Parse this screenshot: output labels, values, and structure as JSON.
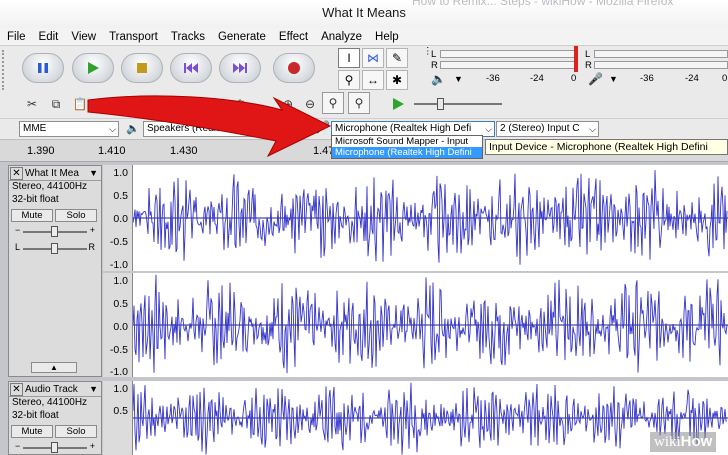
{
  "window": {
    "ghost_title": "How to Remix... Steps - wikiHow - Mozilla Firefox",
    "title": "What It Means"
  },
  "menu": [
    "File",
    "Edit",
    "View",
    "Transport",
    "Tracks",
    "Generate",
    "Effect",
    "Analyze",
    "Help"
  ],
  "transport": {
    "pause": "pause-icon",
    "play": "play-icon",
    "stop": "stop-icon",
    "skip_start": "skip-to-start-icon",
    "skip_end": "skip-to-end-icon",
    "record": "record-icon"
  },
  "meters": {
    "playback_l": "L",
    "playback_r": "R",
    "record_l": "L",
    "record_r": "R",
    "scale_left": [
      "-36",
      "-24",
      "0"
    ],
    "scale_right": [
      "-36",
      "-24",
      "0"
    ]
  },
  "devices": {
    "host": "MME",
    "output": "Speakers (Realtek High De",
    "input": "Microphone (Realtek High Defi",
    "channels": "2 (Stereo) Input C"
  },
  "input_dropdown_options": [
    "Microsoft Sound Mapper - Input",
    "Microphone (Realtek High Defini"
  ],
  "tooltip": "Input Device - Microphone (Realtek High Defini",
  "ruler": [
    "1.390",
    "1.410",
    "1.430",
    "1.47"
  ],
  "tracks": [
    {
      "name": "What It Mea",
      "format": "Stereo, 44100Hz",
      "bitdepth": "32-bit float",
      "mute": "Mute",
      "solo": "Solo",
      "pan_l": "L",
      "pan_r": "R",
      "scale_top": [
        "1.0",
        "0.5",
        "0.0",
        "-0.5",
        "-1.0"
      ],
      "scale_bottom": [
        "1.0",
        "0.5",
        "0.0",
        "-0.5",
        "-1.0"
      ]
    },
    {
      "name": "Audio Track",
      "format": "Stereo, 44100Hz",
      "bitdepth": "32-bit float",
      "mute": "Mute",
      "solo": "Solo",
      "scale_top": [
        "1.0",
        "0.5"
      ]
    }
  ],
  "watermark": {
    "a": "wiki",
    "b": "How"
  },
  "colors": {
    "wave": "#3333cc",
    "arrow": "#e01515",
    "highlight": "#3399ff"
  }
}
